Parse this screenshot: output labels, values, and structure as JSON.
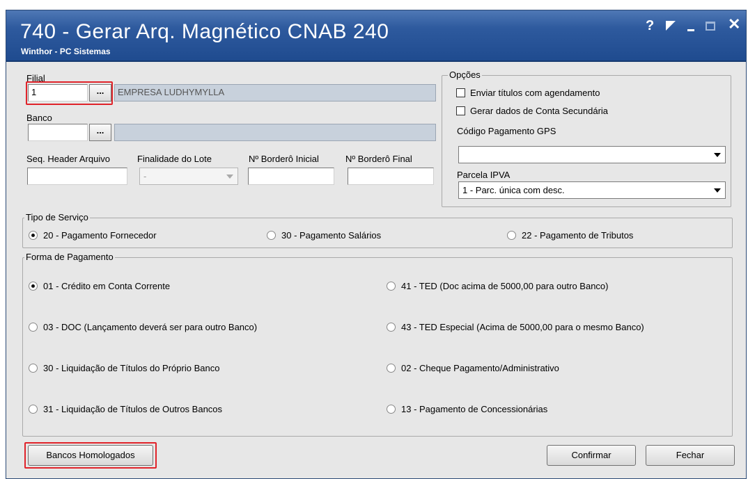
{
  "window": {
    "title": "740 - Gerar Arq. Magnético CNAB 240",
    "subtitle": "Winthor - PC Sistemas",
    "controls": {
      "help": "?",
      "close": "✕"
    }
  },
  "filial": {
    "label": "Filial",
    "code": "1",
    "lookup_label": "...",
    "name": "EMPRESA LUDHYMYLLA"
  },
  "banco": {
    "label": "Banco",
    "code": "",
    "lookup_label": "...",
    "name": ""
  },
  "seq_header": {
    "label": "Seq. Header Arquivo",
    "value": ""
  },
  "finalidade_lote": {
    "label": "Finalidade do Lote",
    "value": "-"
  },
  "bordero_inicial": {
    "label": "Nº Borderô Inicial",
    "value": ""
  },
  "bordero_final": {
    "label": "Nº Borderô Final",
    "value": ""
  },
  "opcoes": {
    "legend": "Opções",
    "enviar_agendamento": "Enviar títulos com agendamento",
    "conta_secundaria": "Gerar dados de Conta Secundária",
    "gps_label": "Código Pagamento GPS",
    "gps_value": "",
    "ipva_label": "Parcela IPVA",
    "ipva_value": "1 - Parc. única com desc."
  },
  "tipo_servico": {
    "legend": "Tipo de Serviço",
    "options": [
      "20 - Pagamento Fornecedor",
      "30 - Pagamento Salários",
      "22 - Pagamento de Tributos"
    ],
    "selected": "20 - Pagamento Fornecedor"
  },
  "forma_pagamento": {
    "legend": "Forma de Pagamento",
    "options": [
      "01 - Crédito em Conta Corrente",
      "41 - TED (Doc acima de 5000,00 para outro Banco)",
      "03 - DOC (Lançamento deverá ser para outro Banco)",
      "43 - TED Especial (Acima de 5000,00 para o mesmo Banco)",
      "30 - Liquidação de Títulos do Próprio Banco",
      "02 - Cheque Pagamento/Administrativo",
      "31 - Liquidação de Títulos de Outros Bancos",
      "13 - Pagamento de Concessionárias"
    ],
    "selected": "01 - Crédito em Conta Corrente"
  },
  "buttons": {
    "bancos_homologados": "Bancos Homologados",
    "confirmar": "Confirmar",
    "fechar": "Fechar"
  }
}
